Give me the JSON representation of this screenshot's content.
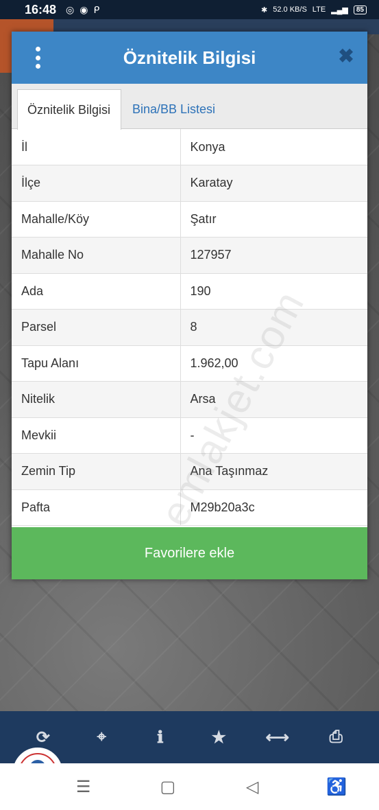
{
  "statusbar": {
    "time": "16:48",
    "speed": "52.0 KB/S",
    "network": "LTE",
    "battery": "85"
  },
  "dialog": {
    "title": "Öznitelik Bilgisi",
    "tabs": [
      {
        "label": "Öznitelik Bilgisi",
        "active": true
      },
      {
        "label": "Bina/BB Listesi",
        "active": false
      }
    ],
    "rows": [
      {
        "key": "İl",
        "value": "Konya"
      },
      {
        "key": "İlçe",
        "value": "Karatay"
      },
      {
        "key": "Mahalle/Köy",
        "value": "Şatır"
      },
      {
        "key": "Mahalle No",
        "value": "127957"
      },
      {
        "key": "Ada",
        "value": "190"
      },
      {
        "key": "Parsel",
        "value": "8"
      },
      {
        "key": "Tapu Alanı",
        "value": "1.962,00"
      },
      {
        "key": "Nitelik",
        "value": "Arsa"
      },
      {
        "key": "Mevkii",
        "value": "-"
      },
      {
        "key": "Zemin Tip",
        "value": "Ana Taşınmaz"
      },
      {
        "key": "Pafta",
        "value": "M29b20a3c"
      }
    ],
    "favorite_button": "Favorilere ekle"
  },
  "watermark": "emlakjet.com",
  "toolbar": {
    "icons": [
      "refresh-icon",
      "locate-icon",
      "info-icon",
      "star-icon",
      "measure-icon",
      "print-icon"
    ]
  },
  "colors": {
    "header": "#3d86c6",
    "favorite": "#5cb85c",
    "toolbar": "#1e3a5f",
    "tab_inactive": "#2d72b8"
  }
}
